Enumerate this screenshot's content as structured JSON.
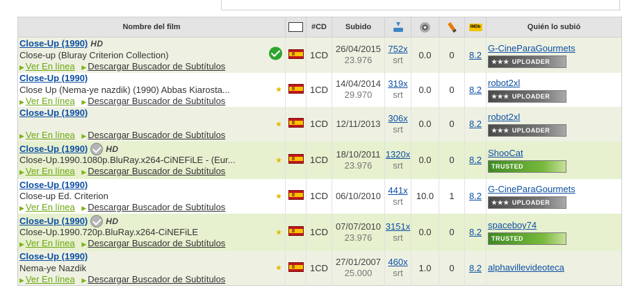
{
  "table": {
    "headers": {
      "name": "Nombre del film",
      "cd": "#CD",
      "uploaded": "Subido",
      "uploader": "Quién lo subió",
      "icons": [
        "screen-icon",
        "download-icon",
        "film-reel-icon",
        "pencil-icon",
        "imdb-icon"
      ],
      "imdb_icon_text": "IMDb"
    },
    "labels": {
      "online": "Ver En línea",
      "download": "Descargar Buscador de Subtítulos"
    },
    "rows": [
      {
        "film": "Close-Up (1990)",
        "hd": "HD",
        "release": "Close-up (Bluray Criterion Collection)",
        "status": "ok-check-icon",
        "language_flag": "flag-es-icon",
        "cd": "1CD",
        "date": "26/04/2015",
        "fps": "23.976",
        "downloads": "752x",
        "format": "srt",
        "rating": "0.0",
        "comments": "0",
        "imdb": "8.2",
        "uploader": "G-CineParaGourmets",
        "badge": "UPLOADER",
        "badge_stars": "★★★"
      },
      {
        "film": "Close-Up (1990)",
        "hd": "",
        "release": "Close Up (Nema-ye nazdik) (1990) Abbas Kiarosta...",
        "status": "star-icon",
        "language_flag": "flag-es-icon",
        "cd": "1CD",
        "date": "14/04/2014",
        "fps": "29.970",
        "downloads": "319x",
        "format": "srt",
        "rating": "0.0",
        "comments": "0",
        "imdb": "8.2",
        "uploader": "robot2xl",
        "badge": "UPLOADER",
        "badge_stars": "★★★"
      },
      {
        "film": "Close-Up (1990)",
        "hd": "",
        "release": "",
        "status": "star-icon",
        "language_flag": "flag-es-icon",
        "cd": "1CD",
        "date": "12/11/2013",
        "fps": "",
        "downloads": "306x",
        "format": "srt",
        "rating": "0.0",
        "comments": "0",
        "imdb": "8.2",
        "uploader": "robot2xl",
        "badge": "UPLOADER",
        "badge_stars": "★★★"
      },
      {
        "film": "Close-Up (1990)",
        "hd": "HD",
        "release": "Close-Up.1990.1080p.BluRay.x264-CiNEFiLE - (Eur...",
        "status": "star-icon",
        "language_flag": "flag-es-icon",
        "cd": "1CD",
        "date": "18/10/2011",
        "fps": "23.976",
        "downloads": "1320x",
        "format": "srt",
        "rating": "0.0",
        "comments": "0",
        "imdb": "8.2",
        "uploader": "ShooCat",
        "badge": "TRUSTED",
        "badge_stars": ""
      },
      {
        "film": "Close-Up (1990)",
        "hd": "",
        "release": "Close-up Ed. Criterion",
        "status": "star-icon",
        "language_flag": "flag-es-icon",
        "cd": "1CD",
        "date": "06/10/2010",
        "fps": "",
        "downloads": "441x",
        "format": "srt",
        "rating": "10.0",
        "comments": "1",
        "imdb": "8.2",
        "uploader": "G-CineParaGourmets",
        "badge": "UPLOADER",
        "badge_stars": "★★★"
      },
      {
        "film": "Close-Up (1990)",
        "hd": "HD",
        "release": "Close-Up.1990.720p.BluRay.x264-CiNEFiLE",
        "status": "star-icon",
        "language_flag": "flag-es-icon",
        "cd": "1CD",
        "date": "07/07/2010",
        "fps": "23.976",
        "downloads": "3151x",
        "format": "srt",
        "rating": "0.0",
        "comments": "0",
        "imdb": "8.2",
        "uploader": "spaceboy74",
        "badge": "TRUSTED",
        "badge_stars": ""
      },
      {
        "film": "Close-Up (1990)",
        "hd": "",
        "release": "Nema-ye Nazdik",
        "status": "star-icon",
        "language_flag": "flag-es-icon",
        "cd": "1CD",
        "date": "27/01/2007",
        "fps": "25.000",
        "downloads": "460x",
        "format": "srt",
        "rating": "1.0",
        "comments": "0",
        "imdb": "8.2",
        "uploader": "alphavillevideoteca",
        "badge": "",
        "badge_stars": ""
      }
    ]
  }
}
